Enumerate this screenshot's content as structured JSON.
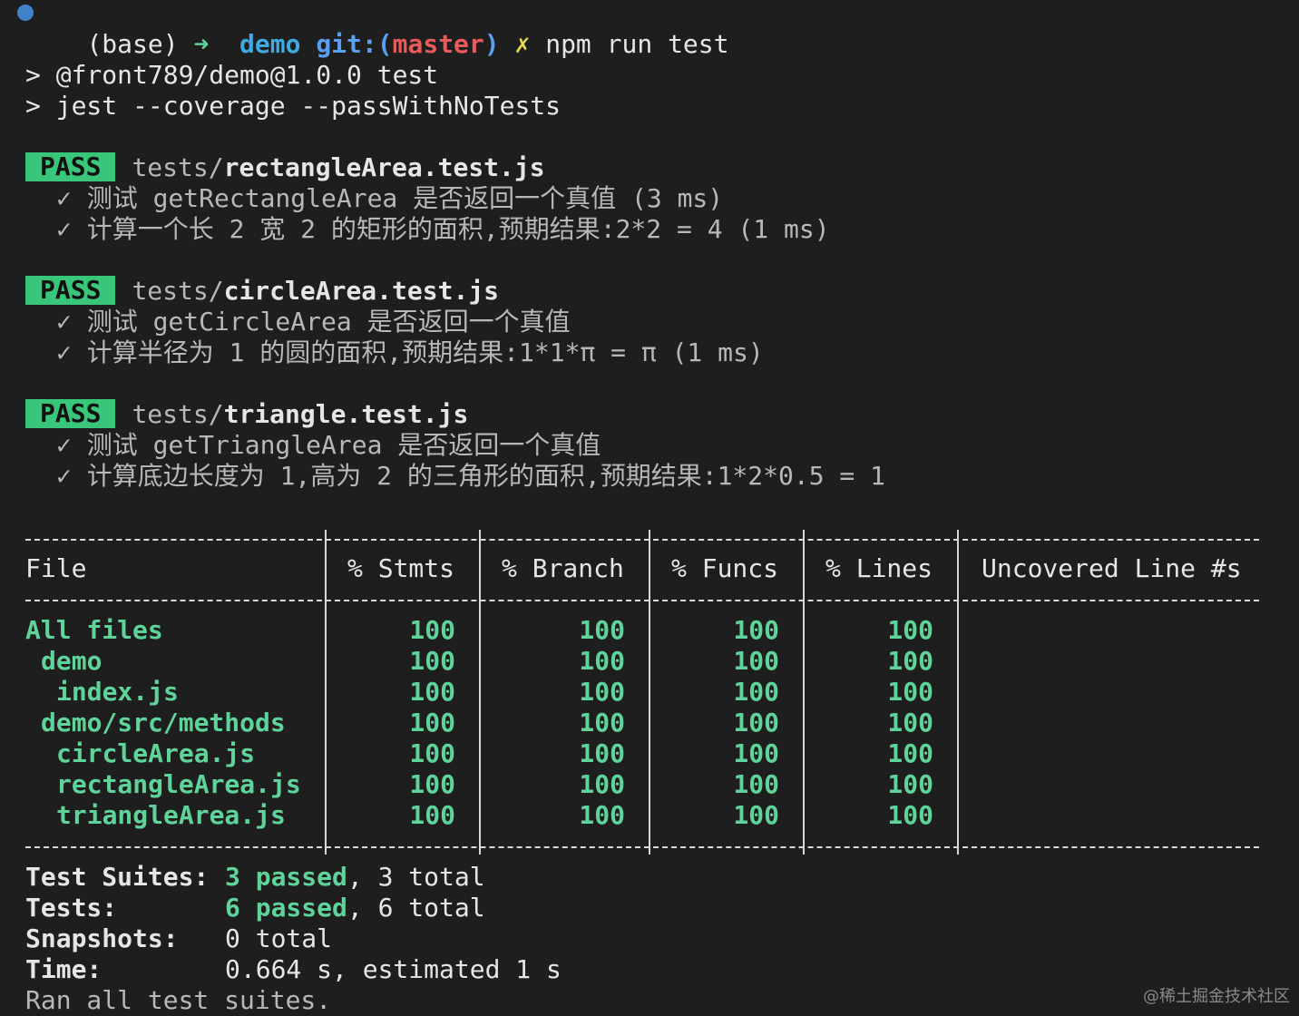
{
  "prompt": {
    "env": "(base)",
    "arrow": "➜",
    "dir": "demo",
    "git_prefix": "git:(",
    "branch": "master",
    "git_suffix": ")",
    "dirty": "✗",
    "command": "npm run test"
  },
  "script_lines": [
    "> @front789/demo@1.0.0 test",
    "> jest --coverage --passWithNoTests"
  ],
  "suites": [
    {
      "status": "PASS",
      "path_prefix": "tests/",
      "file": "rectangleArea.test.js",
      "tests": [
        "✓ 测试 getRectangleArea 是否返回一个真值 (3 ms)",
        "✓ 计算一个长 2 宽 2 的矩形的面积,预期结果:2*2 = 4 (1 ms)"
      ]
    },
    {
      "status": "PASS",
      "path_prefix": "tests/",
      "file": "circleArea.test.js",
      "tests": [
        "✓ 测试 getCircleArea 是否返回一个真值",
        "✓ 计算半径为 1 的圆的面积,预期结果:1*1*π = π (1 ms)"
      ]
    },
    {
      "status": "PASS",
      "path_prefix": "tests/",
      "file": "triangle.test.js",
      "tests": [
        "✓ 测试 getTriangleArea 是否返回一个真值",
        "✓ 计算底边长度为 1,高为 2 的三角形的面积,预期结果:1*2*0.5 = 1"
      ]
    }
  ],
  "coverage": {
    "headers": [
      "File",
      "% Stmts",
      "% Branch",
      "% Funcs",
      "% Lines",
      "Uncovered Line #s"
    ],
    "rows": [
      {
        "file": "All files",
        "indent": 0,
        "stmts": "100",
        "branch": "100",
        "funcs": "100",
        "lines": "100",
        "uncovered": ""
      },
      {
        "file": "demo",
        "indent": 1,
        "stmts": "100",
        "branch": "100",
        "funcs": "100",
        "lines": "100",
        "uncovered": ""
      },
      {
        "file": "index.js",
        "indent": 2,
        "stmts": "100",
        "branch": "100",
        "funcs": "100",
        "lines": "100",
        "uncovered": ""
      },
      {
        "file": "demo/src/methods",
        "indent": 1,
        "stmts": "100",
        "branch": "100",
        "funcs": "100",
        "lines": "100",
        "uncovered": ""
      },
      {
        "file": "circleArea.js",
        "indent": 2,
        "stmts": "100",
        "branch": "100",
        "funcs": "100",
        "lines": "100",
        "uncovered": ""
      },
      {
        "file": "rectangleArea.js",
        "indent": 2,
        "stmts": "100",
        "branch": "100",
        "funcs": "100",
        "lines": "100",
        "uncovered": ""
      },
      {
        "file": "triangleArea.js",
        "indent": 2,
        "stmts": "100",
        "branch": "100",
        "funcs": "100",
        "lines": "100",
        "uncovered": ""
      }
    ]
  },
  "summary": {
    "suites_label": "Test Suites:",
    "suites_passed": "3 passed",
    "suites_total": ", 3 total",
    "tests_label": "Tests:",
    "tests_passed": "6 passed",
    "tests_total": ", 6 total",
    "snapshots_label": "Snapshots:",
    "snapshots_value": "0 total",
    "time_label": "Time:",
    "time_value": "0.664 s, estimated 1 s",
    "ran_all": "Ran all test suites."
  },
  "watermark": "@稀土掘金技术社区",
  "colors": {
    "background": "#1e1e1e",
    "pass_badge": "#38c77a",
    "coverage_green": "#5fd49a",
    "branch_red": "#ea5a5a",
    "git_blue": "#5aa0f0",
    "dir_cyan": "#3fa9e0"
  }
}
